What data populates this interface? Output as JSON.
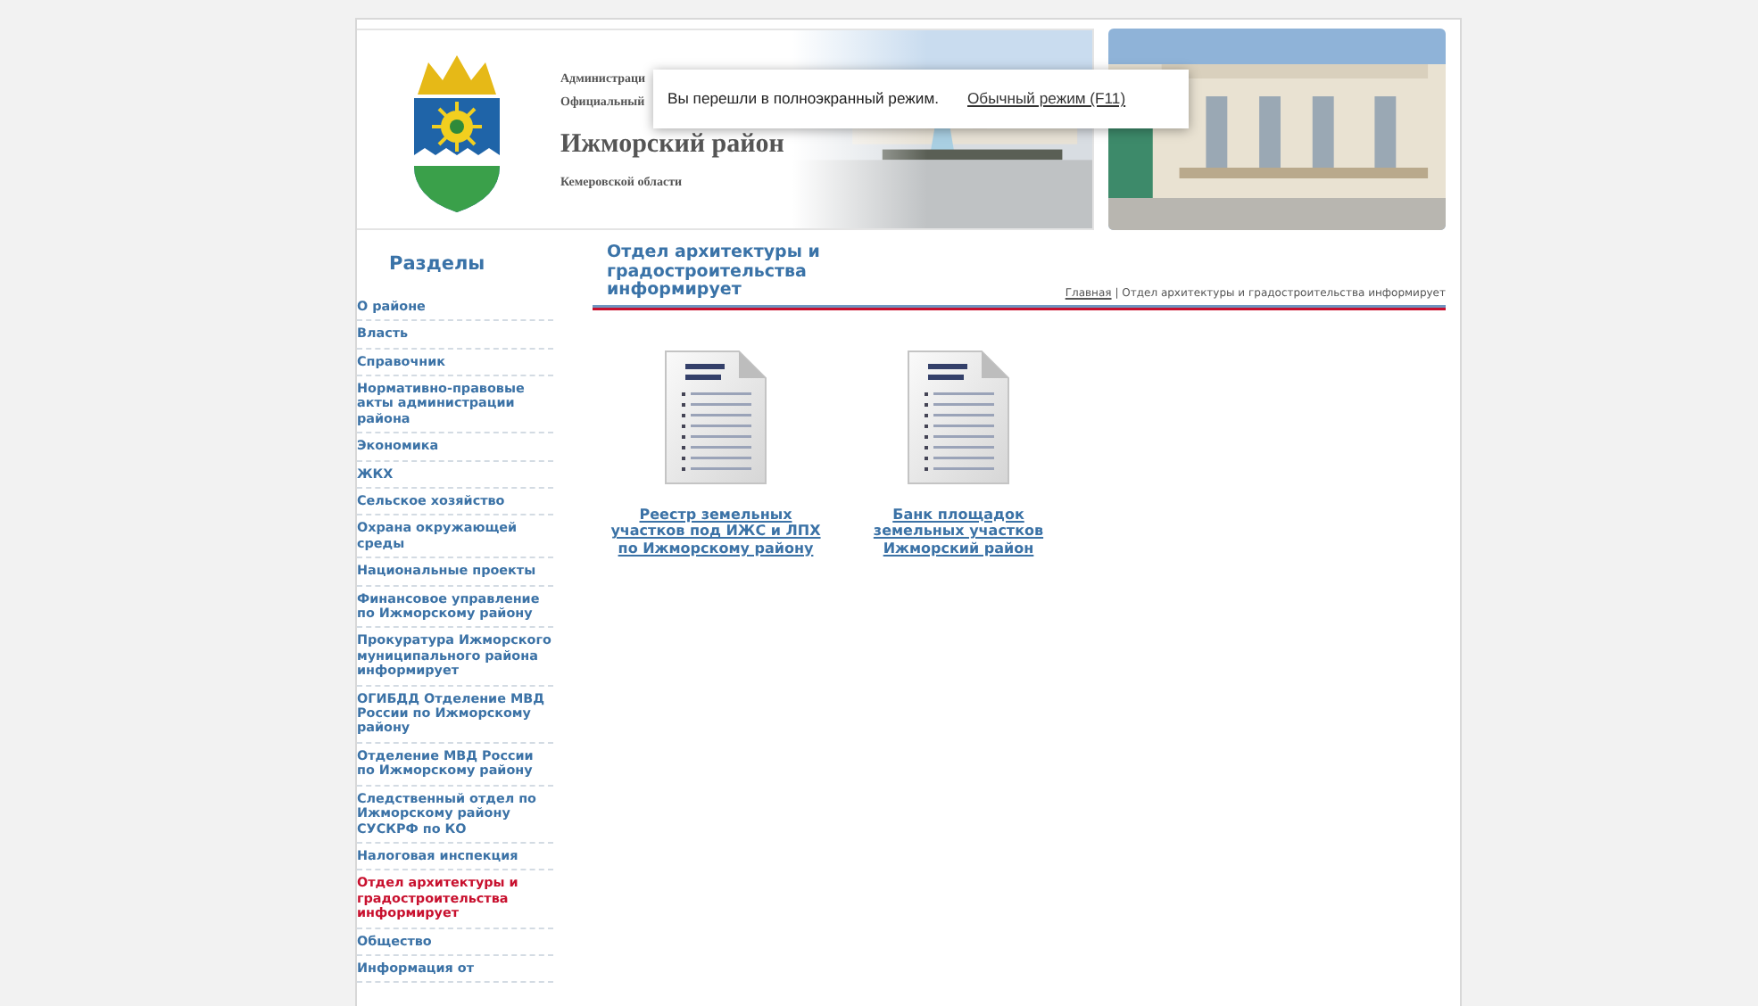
{
  "header": {
    "line_1": "Администраци",
    "line_2": "Официальный",
    "title": "Ижморский район",
    "subtitle": "Кемеровской области"
  },
  "fullscreen_notice": {
    "message": "Вы перешли в полноэкранный режим.",
    "link": "Обычный режим (F11)"
  },
  "sidebar": {
    "title": "Разделы",
    "items": [
      {
        "label": "О районе",
        "selected": false
      },
      {
        "label": "Власть",
        "selected": false
      },
      {
        "label": "Справочник",
        "selected": false
      },
      {
        "label": "Нормативно-правовые акты администрации района",
        "selected": false
      },
      {
        "label": "Экономика",
        "selected": false
      },
      {
        "label": "ЖКХ",
        "selected": false
      },
      {
        "label": "Сельское хозяйство",
        "selected": false
      },
      {
        "label": "Охрана окружающей среды",
        "selected": false
      },
      {
        "label": "Национальные проекты",
        "selected": false
      },
      {
        "label": "Финансовое управление по Ижморскому району",
        "selected": false
      },
      {
        "label": "Прокуратура Ижморского муниципального района информирует",
        "selected": false
      },
      {
        "label": "ОГИБДД Отделение МВД России по Ижморскому району",
        "selected": false
      },
      {
        "label": "Отделение МВД России по Ижморскому району",
        "selected": false
      },
      {
        "label": "Следственный отдел по Ижморскому району СУСКРФ по КО",
        "selected": false
      },
      {
        "label": "Налоговая инспекция",
        "selected": false
      },
      {
        "label": "Отдел архитектуры и градостроительства информирует",
        "selected": true
      },
      {
        "label": "Общество",
        "selected": false
      },
      {
        "label": "Информация от",
        "selected": false
      }
    ]
  },
  "content": {
    "title": "Отдел архитектуры и градостроительства информирует",
    "breadcrumb": {
      "home": "Главная",
      "separator": "|",
      "current": "Отдел архитектуры и градостроительства информирует"
    },
    "documents": [
      {
        "title": "Реестр земельных участков под ИЖС и ЛПХ по Ижморскому району"
      },
      {
        "title": "Банк площадок земельных участков Ижморский район"
      }
    ]
  }
}
